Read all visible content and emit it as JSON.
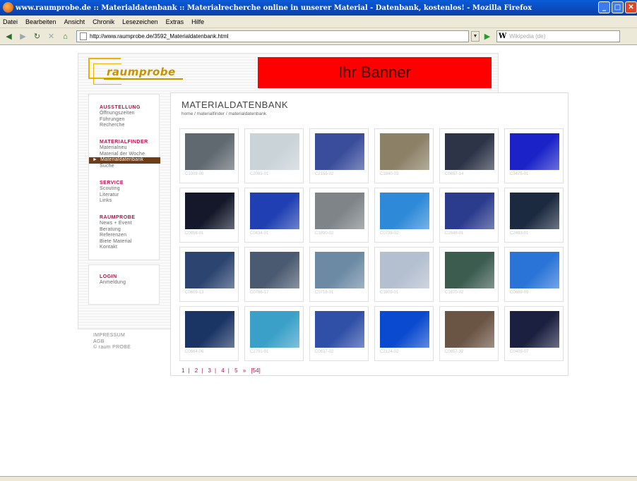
{
  "window": {
    "title": "www.raumprobe.de :: Materialdatenbank :: Materialrecherche online in unserer Material - Datenbank, kostenlos! - Mozilla Firefox"
  },
  "menu": [
    "Datei",
    "Bearbeiten",
    "Ansicht",
    "Chronik",
    "Lesezeichen",
    "Extras",
    "Hilfe"
  ],
  "nav": {
    "url": "http://www.raumprobe.de/3592_Materialdatenbank.html",
    "search_placeholder": "Wikipedia (de)",
    "search_engine": "W"
  },
  "site": {
    "logo_text": "raumprobe",
    "banner_text": "Ihr Banner"
  },
  "sidebar": {
    "sections": [
      {
        "heading": "AUSSTELLUNG",
        "items": [
          "Öffnungszeiten",
          "Führungen",
          "Recherche"
        ]
      },
      {
        "heading": "MATERIALFINDER",
        "items": [
          "Materialneu",
          "Material der Woche",
          "Materialdatenbank",
          "Suche"
        ],
        "active_index": 2
      },
      {
        "heading": "SERVICE",
        "items": [
          "Scouting",
          "Literatur",
          "Links"
        ]
      },
      {
        "heading": "RAUMPROBE",
        "items": [
          "News + Event",
          "Beratung",
          "Referenzen",
          "Biete Material",
          "Kontakt"
        ]
      }
    ],
    "login": {
      "heading": "LOGIN",
      "items": [
        "Anmeldung"
      ]
    }
  },
  "footer": [
    "IMPRESSUM",
    "AGB",
    "© raum PROBE"
  ],
  "main": {
    "title": "MATERIALDATENBANK",
    "breadcrumb": "home / materialfinder / materialdatenbank",
    "tiles": [
      {
        "code": "C1008-08",
        "color": "#606870"
      },
      {
        "code": "C2083-01",
        "color": "#c9d3d8"
      },
      {
        "code": "C2155-02",
        "color": "#3a4c9c"
      },
      {
        "code": "C1840-03",
        "color": "#8c8066"
      },
      {
        "code": "C0657-14",
        "color": "#2d3448"
      },
      {
        "code": "C3475-01",
        "color": "#1a22c8"
      },
      {
        "code": "C0858-01",
        "color": "#14182a"
      },
      {
        "code": "C0434-01",
        "color": "#1f3fb2"
      },
      {
        "code": "C1890-02",
        "color": "#7e8488"
      },
      {
        "code": "C0739-02",
        "color": "#2e8ad8"
      },
      {
        "code": "C2848-01",
        "color": "#2c3c8c"
      },
      {
        "code": "C2483-01",
        "color": "#1c2a40"
      },
      {
        "code": "C0609-13",
        "color": "#2c4470"
      },
      {
        "code": "C0786-17",
        "color": "#4a5a70"
      },
      {
        "code": "C0716-01",
        "color": "#6c8aa4"
      },
      {
        "code": "C1809-01",
        "color": "#b4bfd0"
      },
      {
        "code": "C1870-02",
        "color": "#3c5c50"
      },
      {
        "code": "C0689-05",
        "color": "#2a74d8"
      },
      {
        "code": "C0664-06",
        "color": "#1a3464"
      },
      {
        "code": "C2791-01",
        "color": "#3aa0c8"
      },
      {
        "code": "C0637-02",
        "color": "#3050a8"
      },
      {
        "code": "C2124-02",
        "color": "#0a4ad0"
      },
      {
        "code": "C0857-32",
        "color": "#6a5444"
      },
      {
        "code": "C0409-07",
        "color": "#1c2040"
      }
    ],
    "pager": {
      "pages": [
        "1",
        "2",
        "3",
        "4",
        "5"
      ],
      "next": "»",
      "last": "[54]"
    }
  }
}
